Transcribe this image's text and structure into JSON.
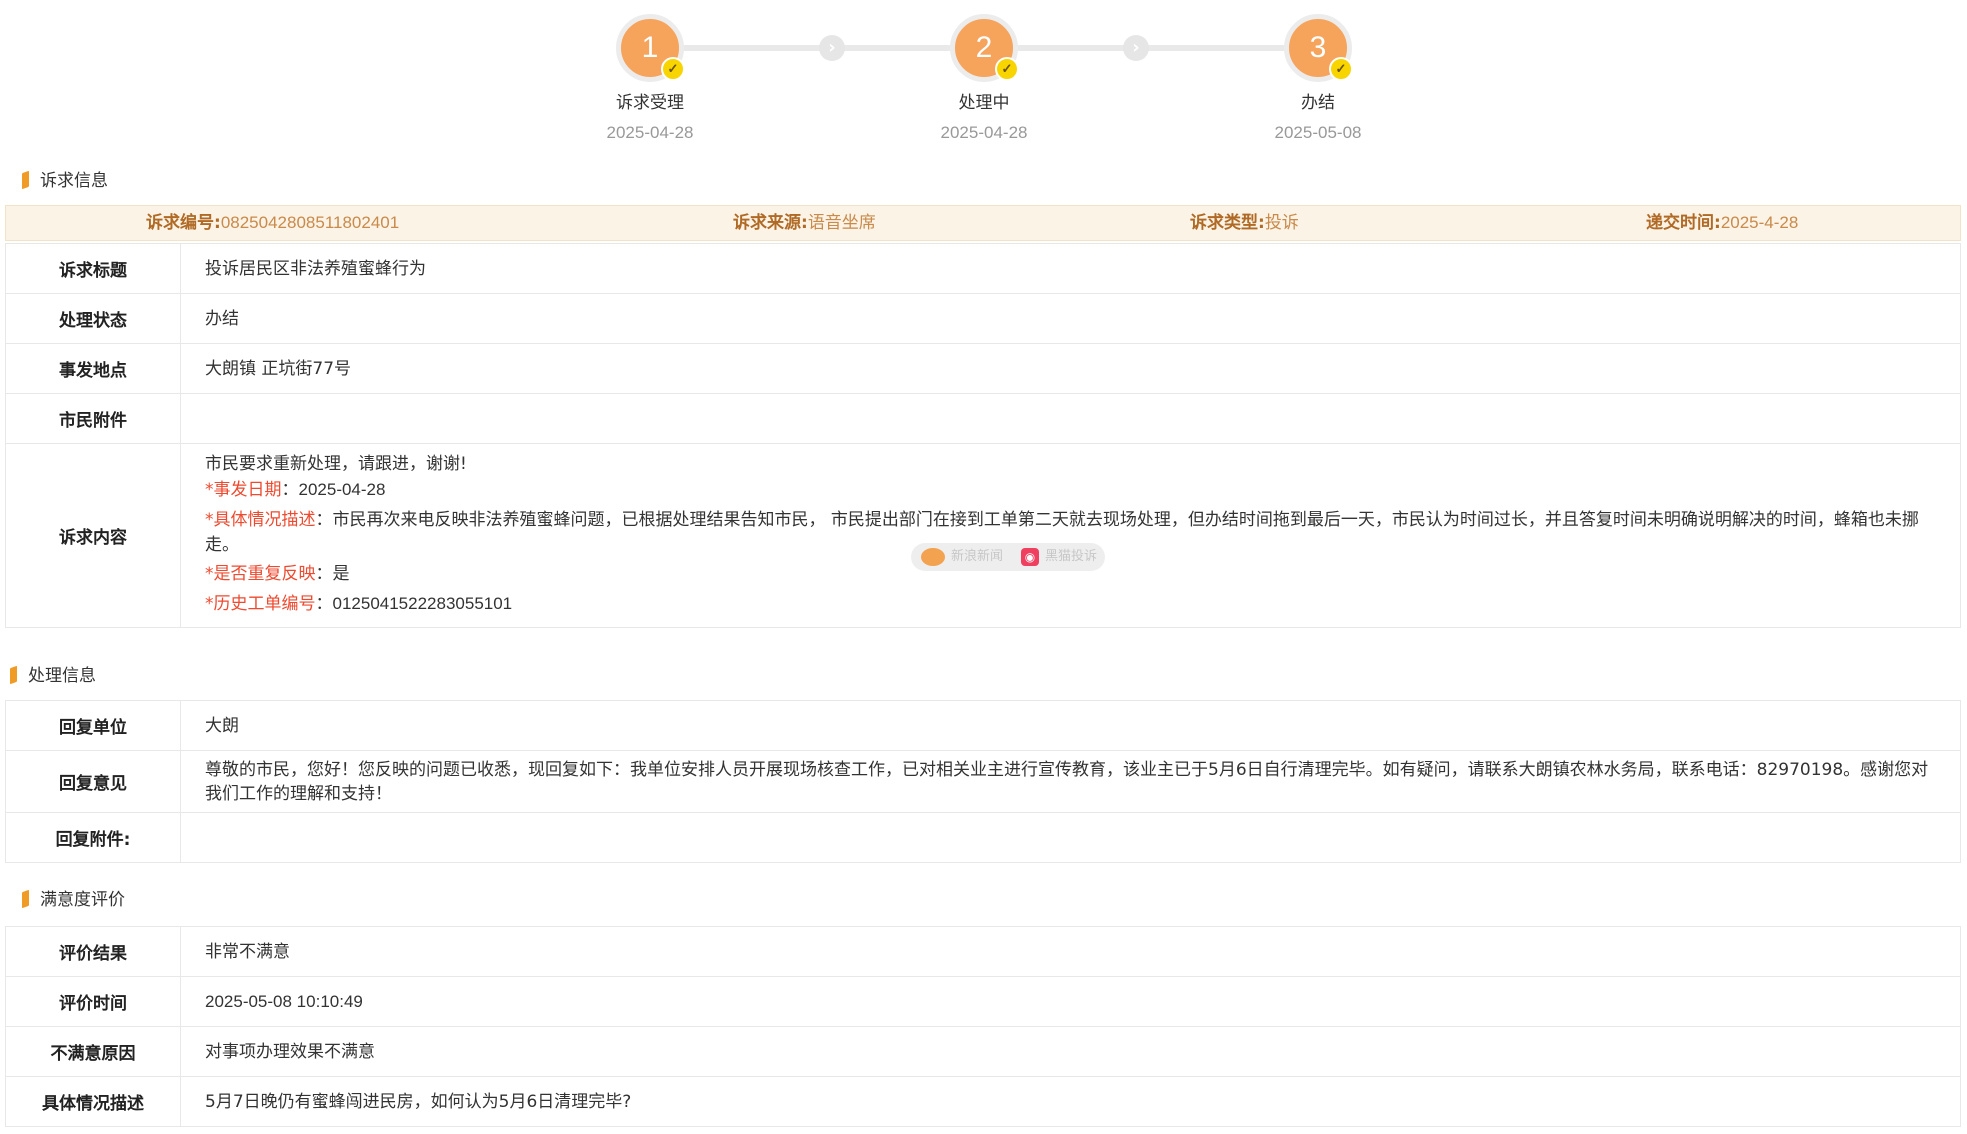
{
  "steps": [
    {
      "number": "1",
      "label": "诉求受理",
      "date": "2025-04-28"
    },
    {
      "number": "2",
      "label": "处理中",
      "date": "2025-04-28"
    },
    {
      "number": "3",
      "label": "办结",
      "date": "2025-05-08"
    }
  ],
  "sections": {
    "complaint": "诉求信息",
    "handling": "处理信息",
    "satisfaction": "满意度评价"
  },
  "summary": {
    "id_label": "诉求编号:",
    "id_value": "0825042808511802401",
    "source_label": "诉求来源:",
    "source_value": "语音坐席",
    "type_label": "诉求类型:",
    "type_value": "投诉",
    "time_label": "递交时间:",
    "time_value": "2025-4-28"
  },
  "complaint": {
    "title_label": "诉求标题",
    "title_value": "投诉居民区非法养殖蜜蜂行为",
    "status_label": "处理状态",
    "status_value": "办结",
    "location_label": "事发地点",
    "location_value": "大朗镇 正坑街77号",
    "attachment_label": "市民附件",
    "content_label": "诉求内容",
    "content_intro": "市民要求重新处理，请跟进，谢谢!",
    "date_key": "*事发日期",
    "date_value": "2025-04-28",
    "desc_key": "*具体情况描述",
    "desc_value": "市民再次来电反映非法养殖蜜蜂问题，已根据处理结果告知市民， 市民提出部门在接到工单第二天就去现场处理，但办结时间拖到最后一天，市民认为时间过长，并且答复时间未明确说明解决的时间，蜂箱也未挪走。",
    "repeat_key": "*是否重复反映",
    "repeat_value": "是",
    "history_key": "*历史工单编号",
    "history_value": "0125041522283055101"
  },
  "handling": {
    "unit_label": "回复单位",
    "unit_value": "大朗",
    "opinion_label": "回复意见",
    "opinion_value": "尊敬的市民，您好！您反映的问题已收悉，现回复如下：我单位安排人员开展现场核查工作，已对相关业主进行宣传教育，该业主已于5月6日自行清理完毕。如有疑问，请联系大朗镇农林水务局，联系电话：82970198。感谢您对我们工作的理解和支持！",
    "attachment_label": "回复附件:"
  },
  "satisfaction": {
    "result_label": "评价结果",
    "result_value": "非常不满意",
    "time_label": "评价时间",
    "time_value": "2025-05-08 10:10:49",
    "reason_label": "不满意原因",
    "reason_value": "对事项办理效果不满意",
    "desc_label": "具体情况描述",
    "desc_value": "5月7日晚仍有蜜蜂闯进民房，如何认为5月6日清理完毕?"
  },
  "watermark": {
    "left": "新浪新闻",
    "right": "黑猫投诉"
  },
  "colors": {
    "accent": "#f6a35b",
    "label_brown": "#b06a25",
    "required_red": "#ee4a2f"
  }
}
